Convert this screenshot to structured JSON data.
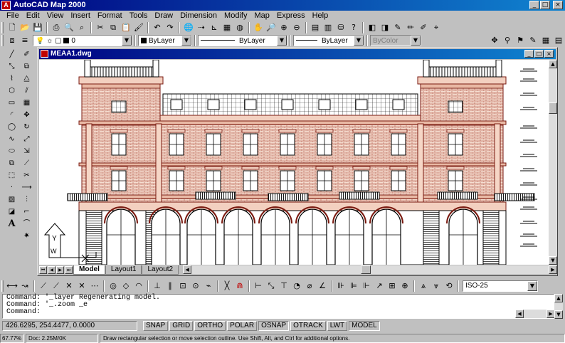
{
  "app": {
    "title": "AutoCAD Map 2000"
  },
  "menu": [
    "File",
    "Edit",
    "View",
    "Insert",
    "Format",
    "Tools",
    "Draw",
    "Dimension",
    "Modify",
    "Map",
    "Express",
    "Help"
  ],
  "properties": {
    "layer": "0",
    "color": "ByLayer",
    "linetype": "ByLayer",
    "lineweight": "ByLayer",
    "plotstyle": "ByColor"
  },
  "drawing": {
    "filename": "MEAA1.dwg",
    "tabs": [
      "Model",
      "Layout1",
      "Layout2"
    ],
    "active_tab": "Model",
    "ucs_label": "Y",
    "ucs_w": "W"
  },
  "dimstyle": "ISO-25",
  "command": {
    "lines": [
      "Command: '_layer Regenerating model.",
      "Command: '_.zoom _e",
      "Command:"
    ]
  },
  "status": {
    "coordinates": "426.6295, 254.4477, 0.0000",
    "modes": [
      "SNAP",
      "GRID",
      "ORTHO",
      "POLAR",
      "OSNAP",
      "OTRACK",
      "LWT",
      "MODEL"
    ]
  },
  "footer": {
    "zoom": "67.77%",
    "doc": "Doc: 2.25M/0K",
    "hint": "Draw rectangular selection or move selection outline. Use Shift, Alt, and Ctrl for additional options."
  },
  "colors": {
    "facade": "#8b1a1a",
    "facade_fill": "#f3d9cc",
    "titlebar": "#000080"
  }
}
